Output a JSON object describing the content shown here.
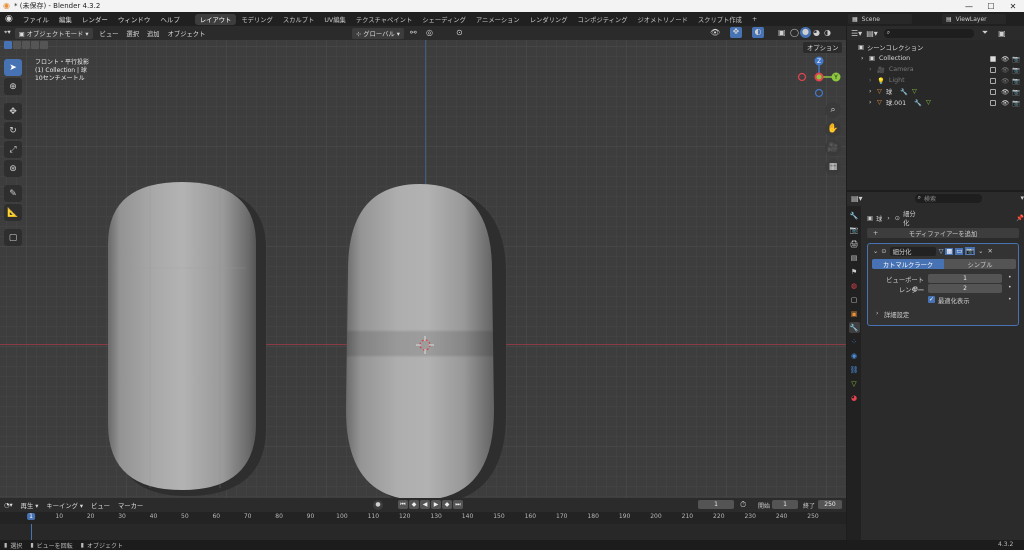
{
  "window": {
    "title": "* (未保存) - Blender 4.3.2",
    "minimize": "—",
    "maximize": "☐",
    "close": "✕"
  },
  "menu": {
    "items": [
      "ファイル",
      "編集",
      "レンダー",
      "ウィンドウ",
      "ヘルプ"
    ],
    "workspaces": [
      "レイアウト",
      "モデリング",
      "スカルプト",
      "UV編集",
      "テクスチャペイント",
      "シェーディング",
      "アニメーション",
      "レンダリング",
      "コンポジティング",
      "ジオメトリノード",
      "スクリプト作成"
    ],
    "active_workspace": "レイアウト",
    "add_tab": "+",
    "scene": "Scene",
    "view_layer": "ViewLayer"
  },
  "viewport": {
    "mode": "オブジェクトモード",
    "menus": [
      "ビュー",
      "選択",
      "追加",
      "オブジェクト"
    ],
    "orientation": "グローバル",
    "options": "オプション",
    "overlay_lines": [
      "フロント・平行投影",
      "(1) Collection | 球",
      "10センチメートル"
    ],
    "gizmo": {
      "x": "X",
      "y": "Y",
      "z": "Z"
    }
  },
  "timeline": {
    "playback": "再生",
    "keying": "キーイング",
    "view": "ビュー",
    "marker": "マーカー",
    "current_frame": "1",
    "start_label": "開始",
    "start": "1",
    "end_label": "終了",
    "end": "250",
    "ticks": [
      "1",
      "10",
      "20",
      "30",
      "40",
      "50",
      "60",
      "70",
      "80",
      "90",
      "100",
      "110",
      "120",
      "130",
      "140",
      "150",
      "160",
      "170",
      "180",
      "190",
      "200",
      "210",
      "220",
      "230",
      "240",
      "250"
    ]
  },
  "status": {
    "select": "選択",
    "rotate": "ビューを回転",
    "object": "オブジェクト",
    "version": "4.3.2"
  },
  "outliner": {
    "search_placeholder": "",
    "root": "シーンコレクション",
    "items": [
      {
        "label": "Collection",
        "indent": 1,
        "icon": "collection-icon"
      },
      {
        "label": "Camera",
        "indent": 2,
        "icon": "camera-icon",
        "dim": true
      },
      {
        "label": "Light",
        "indent": 2,
        "icon": "light-icon",
        "dim": true
      },
      {
        "label": "球",
        "indent": 2,
        "icon": "mesh-icon",
        "dim": false
      },
      {
        "label": "球.001",
        "indent": 2,
        "icon": "mesh-icon",
        "dim": false
      }
    ]
  },
  "properties": {
    "search_placeholder": "検索",
    "breadcrumb_object": "球",
    "breadcrumb_modifier": "細分化",
    "add_modifier": "モディファイアーを追加",
    "modifier_name": "細分化",
    "tab_catmull": "カトマルクラーク",
    "tab_simple": "シンプル",
    "viewport_label": "ビューポートの...",
    "viewport_value": "1",
    "render_label": "レンダー",
    "render_value": "2",
    "optimal_label": "最適化表示",
    "advanced_label": "詳細設定"
  },
  "colors": {
    "accent": "#4772b3",
    "x_axis": "#e2434f",
    "y_axis": "#8cc73f",
    "z_axis": "#4378c8",
    "orange": "#e8903b"
  }
}
